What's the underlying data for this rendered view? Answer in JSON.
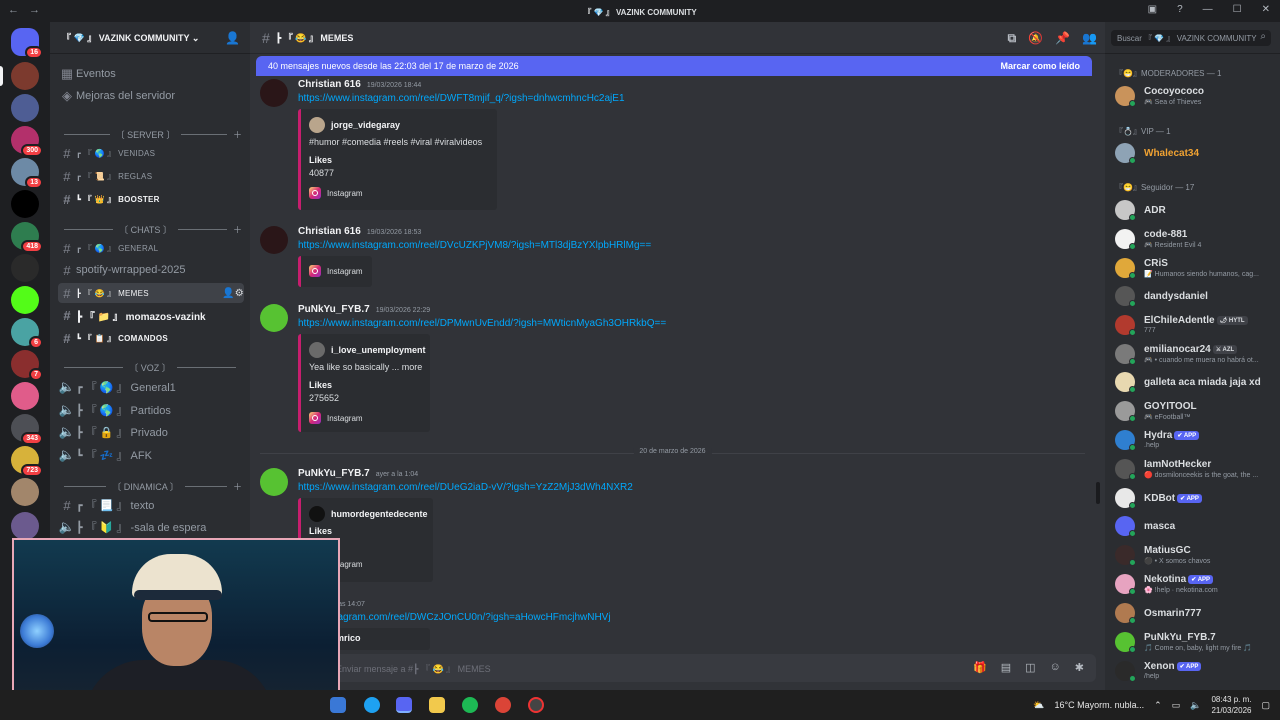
{
  "window": {
    "title": "『 💎 』 VAZINK COMMUNITY"
  },
  "rail": {
    "servers": [
      {
        "name": "Direct messages",
        "badge": "16",
        "color": "#5865f2"
      },
      {
        "name": "Server 1",
        "badge": "",
        "color": "#7c3a2e"
      },
      {
        "name": "Squad",
        "badge": "",
        "color": "#4e5d94"
      },
      {
        "name": "Server 3",
        "badge": "300",
        "color": "#b3306b"
      },
      {
        "name": "Server 4",
        "badge": "13",
        "color": "#6d8aa6"
      },
      {
        "name": "TikTok",
        "badge": "",
        "color": "#000000"
      },
      {
        "name": "Server 6",
        "badge": "418",
        "color": "#2e7d4f"
      },
      {
        "name": "Server 7",
        "badge": "",
        "color": "#2a2a2a"
      },
      {
        "name": "Kick",
        "badge": "",
        "color": "#53fc18"
      },
      {
        "name": "Server 9",
        "badge": "6",
        "color": "#4aa3a3"
      },
      {
        "name": "Server 10",
        "badge": "7",
        "color": "#8a2e2e"
      },
      {
        "name": "Server 11",
        "badge": "",
        "color": "#e05c8a"
      },
      {
        "name": "Server 12",
        "badge": "343",
        "color": "#4d4f55"
      },
      {
        "name": "Server 13",
        "badge": "723",
        "color": "#d7b23a"
      },
      {
        "name": "Server 14",
        "badge": "",
        "color": "#a2866b"
      },
      {
        "name": "Server 15",
        "badge": "",
        "color": "#6b5a8e"
      }
    ]
  },
  "guild": {
    "name": "『 💎 』 VAZINK COMMUNITY ⌄",
    "top_items": [
      "Eventos",
      "Mejoras del servidor"
    ],
    "categories": {
      "server": "〔 SERVER 〕",
      "chats": "〔 CHATS 〕",
      "voz": "〔 VOZ 〕",
      "dinamica": "〔 DINAMICA 〕"
    },
    "channels": {
      "venidas": "┏ 『 🌎 』 VENIDAS",
      "reglas": "┏ 『 📜 』 REGLAS",
      "booster": "┗ 『 👑 』 BOOSTER",
      "general": "┏ 『 🌎 』 GENERAL",
      "spotify": "spotify-wrrapped-2025",
      "memes": "┣ 『 😂 』 MEMES",
      "momazos": "┣ 『 📁 』 momazos-vazink",
      "comandos": "┗ 『 📋 』 COMANDOS",
      "general1": "┏ 『 🌎 』 General1",
      "partidos": "┣ 『 🌎 』 Partidos",
      "privado": "┣ 『 🔒 』 Privado",
      "afk": "┗ 『 💤 』 AFK",
      "texto": "┏ 『 📃 』 texto",
      "sala": "┣ 『 🔰 』 -sala de espera"
    }
  },
  "chat": {
    "channel_title": "┣ 『 😂 』 MEMES",
    "new_messages": "40 mensajes nuevos desde las 22:03 del 17 de marzo de 2026",
    "mark_read": "Marcar como leído",
    "date_divider": "20 de marzo de 2026",
    "placeholder": "Enviar mensaje a #┣ 『 😂 』 MEMES",
    "messages": [
      {
        "author": "Christian 616",
        "time": "19/03/2026 18:44",
        "link": "https://www.instagram.com/reel/DWFT8mjif_q/?igsh=dnhwcmhncHc2ajE1",
        "embed": {
          "author": "jorge_videgaray",
          "desc": "#humor #comedia #reels #viral #viralvideos",
          "field": "Likes",
          "value": "40877",
          "footer": "Instagram"
        }
      },
      {
        "author": "Christian 616",
        "time": "19/03/2026 18:53",
        "link": "https://www.instagram.com/reel/DVcUZKPjVM8/?igsh=MTl3djBzYXlpbHRlMg==",
        "embed": {
          "footer": "Instagram"
        }
      },
      {
        "author": "PuNkYu_FYB.7",
        "time": "19/03/2026 22:29",
        "link": "https://www.instagram.com/reel/DPMwnUvEndd/?igsh=MWticnMyaGh3OHRkbQ==",
        "embed": {
          "author": "i_love_unemployment",
          "desc": "Yea like so basically ... more",
          "field": "Likes",
          "value": "275652",
          "footer": "Instagram"
        }
      },
      {
        "author": "PuNkYu_FYB.7",
        "time": "ayer a la 1:04",
        "link": "https://www.instagram.com/reel/DUeG2iaD-vV/?igsh=YzZ2MjJ3dWh4NXR2",
        "embed": {
          "author": "humordegentedecente",
          "field": "Likes",
          "footer": "Instagram"
        }
      },
      {
        "author": "03",
        "time": "ayer a las 14:07",
        "link": "www.instagram.com/reel/DWCzJOnCU0n/?igsh=aHowcHFmcjhwNHVj",
        "embed": {
          "author": "ntiagomrico"
        }
      }
    ]
  },
  "members": {
    "search": "Buscar 『 💎 』 VAZINK COMMUNITY",
    "groups": [
      {
        "title": "『😁』MODERADORES — 1"
      },
      {
        "title": "『💍』VIP — 1"
      },
      {
        "title": "『😁』Seguidor — 17"
      }
    ],
    "list": [
      {
        "name": "Cocoyococo",
        "status": "🎮 Sea of Thieves",
        "color": "#dbdee1",
        "av": "#c9935b"
      },
      {
        "name": "Whalecat34",
        "status": "",
        "color": "#f0a232",
        "av": "#8ea3b5"
      },
      {
        "name": "ADR",
        "status": "",
        "color": "#dbdee1",
        "av": "#c7c7c7"
      },
      {
        "name": "code-881",
        "status": "🎮 Resident Evil 4",
        "color": "#dbdee1",
        "av": "#f2f2f2"
      },
      {
        "name": "CRiS",
        "status": "📝 Humanos siendo humanos, cag...",
        "color": "#dbdee1",
        "av": "#e0a83a"
      },
      {
        "name": "dandysdaniel",
        "status": "",
        "color": "#dbdee1",
        "av": "#565656"
      },
      {
        "name": "ElChileAdentle",
        "tag": "🌶 HYTL",
        "status": "777",
        "color": "#dbdee1",
        "av": "#b23a2e"
      },
      {
        "name": "emilianocar24",
        "tag": "⚔ AZL",
        "status": "🎮 • cuando me muera no habrá ot...",
        "color": "#dbdee1",
        "av": "#7a7a7a"
      },
      {
        "name": "galleta aca miada jaja xd",
        "status": "",
        "color": "#dbdee1",
        "av": "#e8d8b0"
      },
      {
        "name": "GOYITOOL",
        "status": "🎮 eFootball™",
        "color": "#dbdee1",
        "av": "#9a9a9a"
      },
      {
        "name": "Hydra",
        "tag": "✔ APP",
        "status": ".help",
        "color": "#dbdee1",
        "av": "#2f7fd0"
      },
      {
        "name": "IamNotHecker",
        "status": "🔴 dosmilonceekis is the goat, the ...",
        "color": "#dbdee1",
        "av": "#555555"
      },
      {
        "name": "KDBot",
        "tag": "✔ APP",
        "status": "",
        "color": "#dbdee1",
        "av": "#e8e8e8"
      },
      {
        "name": "masca",
        "status": "",
        "color": "#dbdee1",
        "av": "#5865f2"
      },
      {
        "name": "MatiusGC",
        "status": "⚫ • X somos chavos",
        "color": "#dbdee1",
        "av": "#3a2a2a"
      },
      {
        "name": "Nekotina",
        "tag": "✔ APP",
        "status": "🌸 !help · nekotina.com",
        "color": "#dbdee1",
        "av": "#e7a3c0"
      },
      {
        "name": "Osmarin777",
        "status": "",
        "color": "#dbdee1",
        "av": "#b07a50"
      },
      {
        "name": "PuNkYu_FYB.7",
        "status": "🎵 Come on, baby, light my fire 🎵",
        "color": "#dbdee1",
        "av": "#57c232"
      },
      {
        "name": "Xenon",
        "tag": "✔ APP",
        "status": "/help",
        "color": "#dbdee1",
        "av": "#2a2a2a"
      }
    ]
  },
  "taskbar": {
    "weather": "16°C  Mayorm. nubla...",
    "time": "08:43 p. m.",
    "date": "21/03/2026"
  },
  "colors": {
    "accent": "#5865f2",
    "link": "#00a8fc",
    "embed_border": "#c71e6e",
    "online": "#23a55a"
  }
}
